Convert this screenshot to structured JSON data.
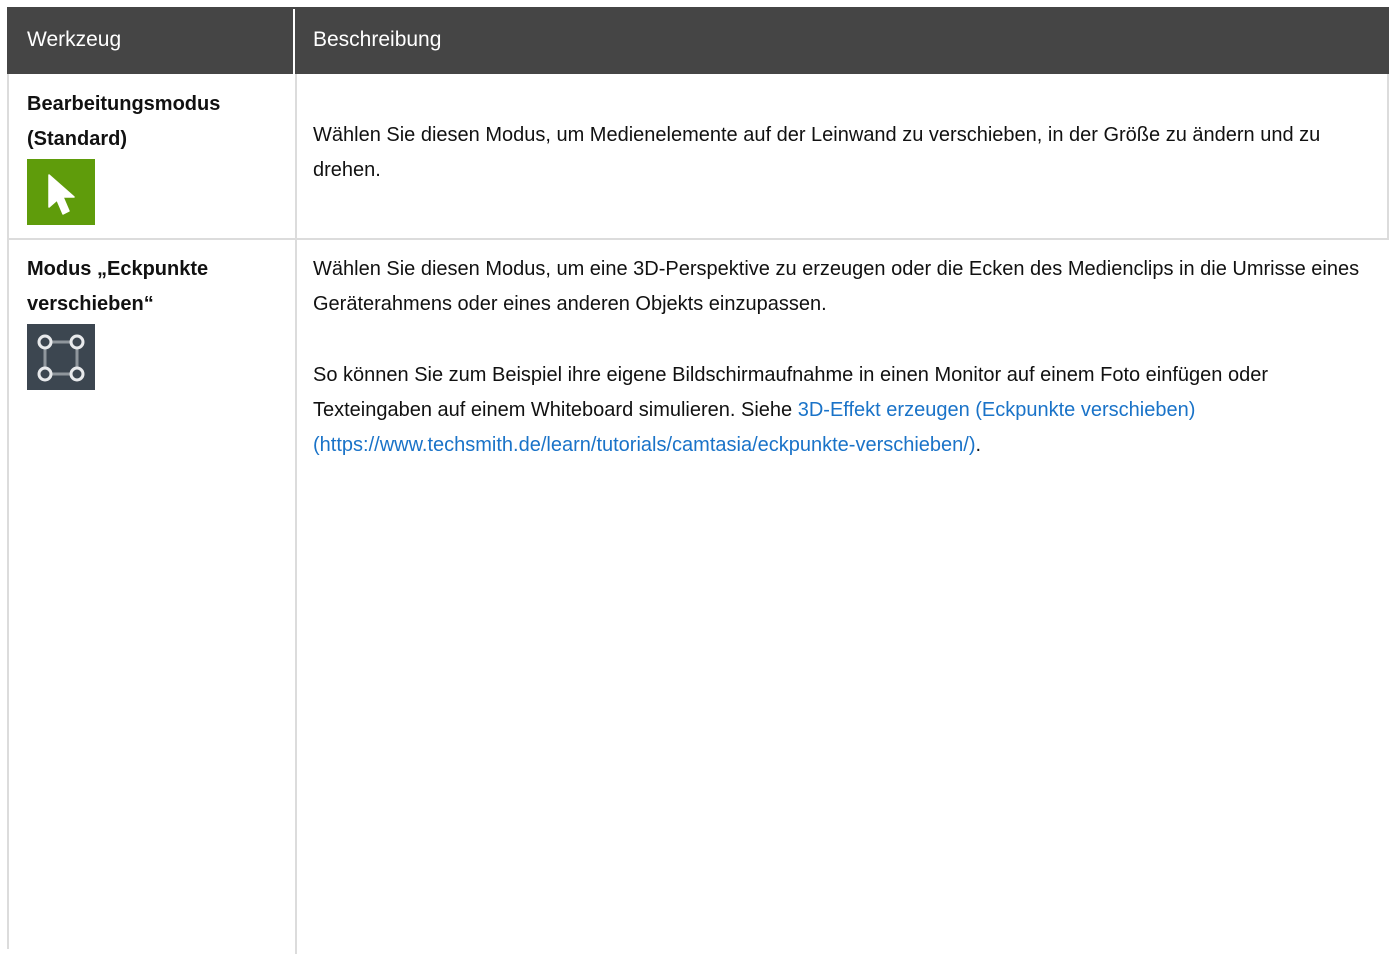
{
  "header": {
    "col_tool": "Werkzeug",
    "col_description": "Beschreibung"
  },
  "rows": [
    {
      "tool_line1": "Bearbeitungsmodus",
      "tool_line2": "(Standard)",
      "icon": "cursor-arrow-icon",
      "icon_color": "#5f9c0b",
      "description": "Wählen Sie diesen Modus, um Medienelemente auf der Leinwand zu verschieben, in der Größe zu ändern und zu drehen."
    },
    {
      "tool_line1": "Modus „Eckpunkte",
      "tool_line2": "verschieben“",
      "icon": "corner-pin-icon",
      "icon_color": "#3c4650",
      "description_p1": "Wählen Sie diesen Modus, um eine 3D-Perspektive zu erzeugen oder die Ecken des Medienclips in die Umrisse eines Geräterahmens oder eines anderen Objekts einzupassen.",
      "description_p2_text": "So können Sie zum Beispiel ihre eigene Bildschirmaufnahme in einen Monitor auf einem Foto einfügen oder Texteingaben auf einem Whiteboard simulieren. Siehe ",
      "description_p2_link": "3D-Effekt erzeugen (Eckpunkte verschieben) (https://www.techsmith.de/learn/tutorials/camtasia/eckpunkte-verschieben/)",
      "description_p2_end": "."
    }
  ],
  "colors": {
    "header_bg": "#454545",
    "link": "#1a73c8"
  }
}
